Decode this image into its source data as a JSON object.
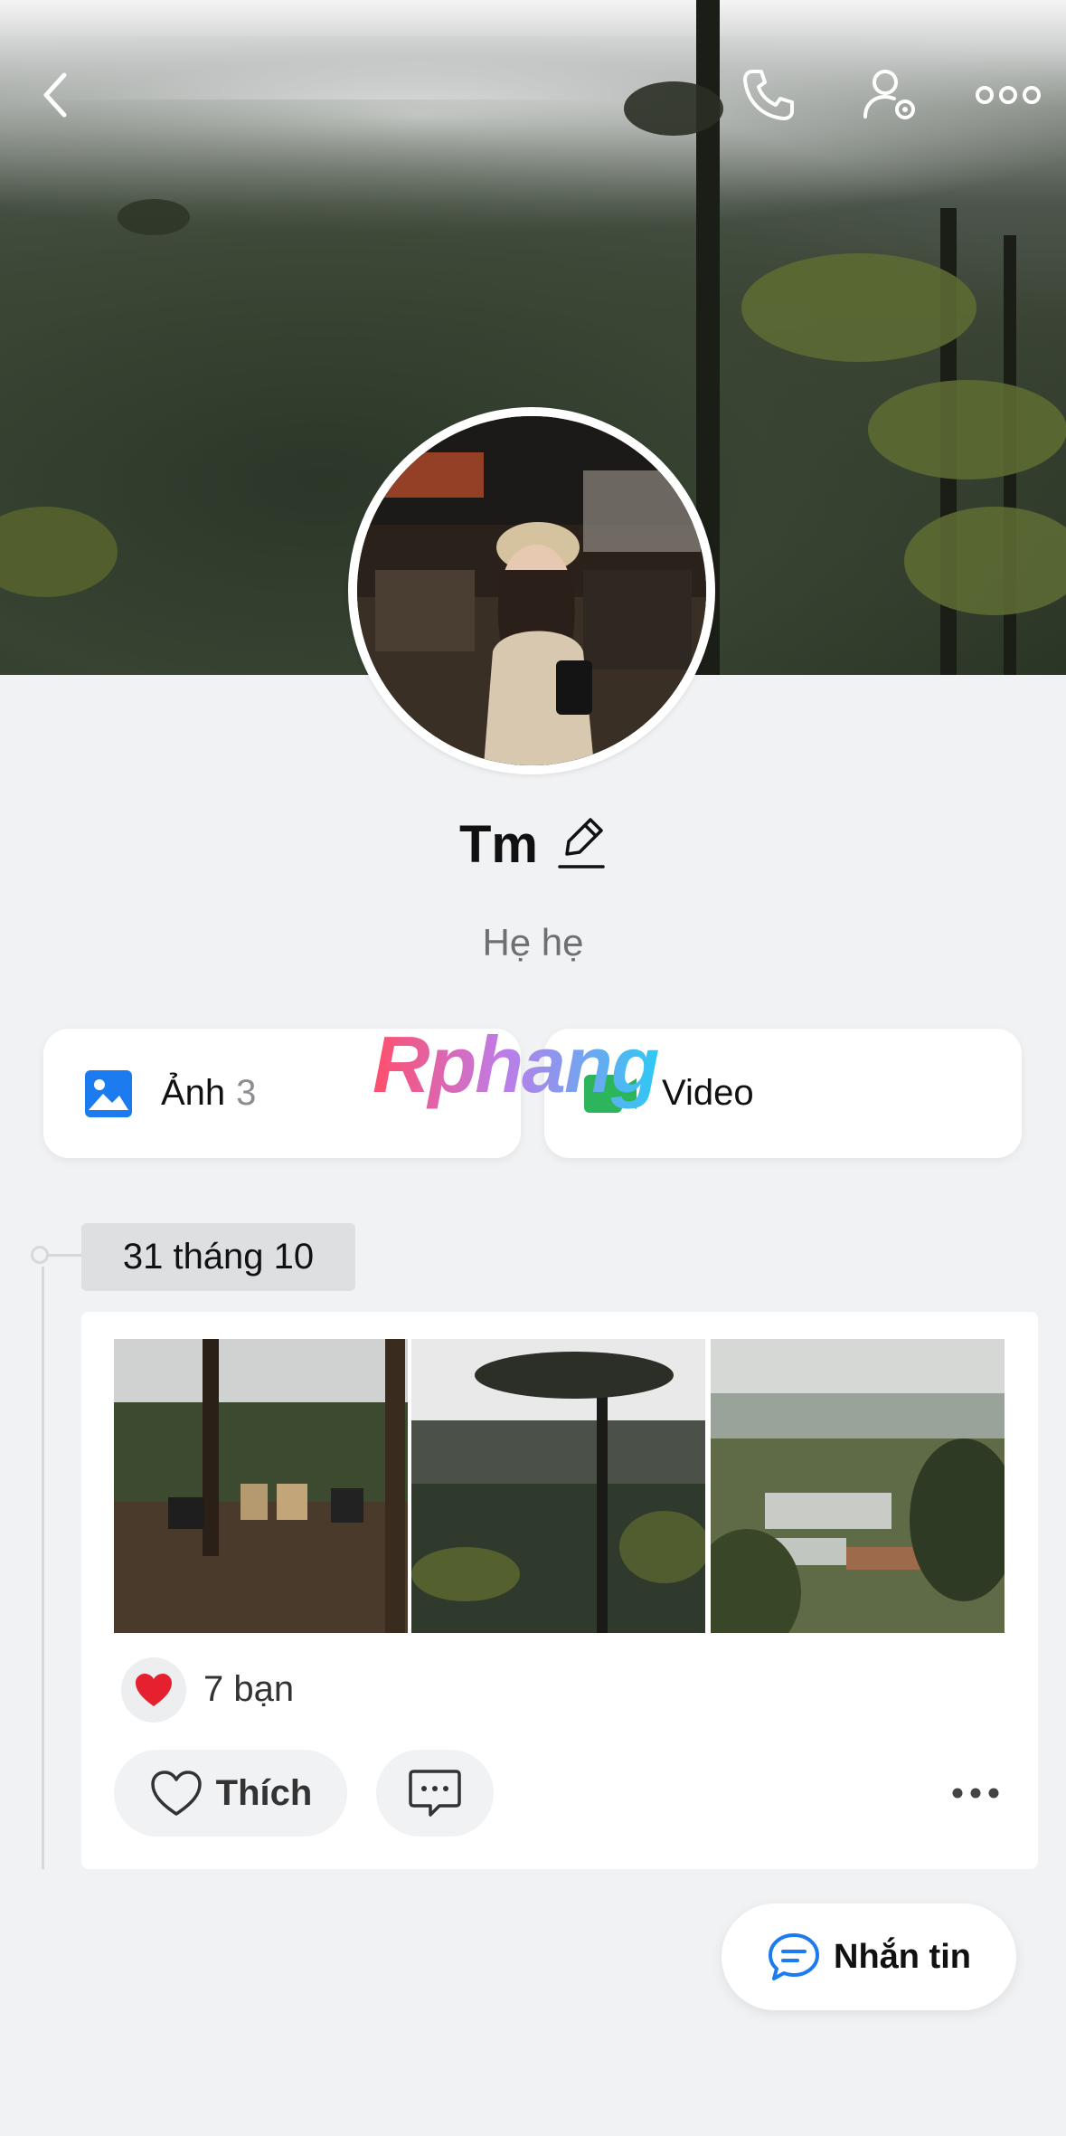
{
  "header": {
    "back_icon": "chevron-left-icon",
    "call_icon": "phone-icon",
    "settings_icon": "user-settings-icon",
    "more_icon": "more-horizontal-icon"
  },
  "profile": {
    "name": "Tm",
    "bio": "Hẹ hẹ",
    "edit_icon": "pencil-icon"
  },
  "media_tiles": [
    {
      "label": "Ảnh",
      "count": "3",
      "icon": "image-icon"
    },
    {
      "label": "Video",
      "icon": "video-icon"
    }
  ],
  "watermark": "Rphang",
  "timeline": {
    "date": "31 tháng 10"
  },
  "post": {
    "reaction_icon": "heart-icon",
    "reaction_count": "7 bạn",
    "like_label": "Thích",
    "comment_icon": "comment-icon",
    "more_icon": "more-horizontal-icon"
  },
  "fab": {
    "label": "Nhắn tin",
    "icon": "chat-bubble-icon"
  },
  "colors": {
    "background": "#f1f2f4",
    "card": "#ffffff",
    "accent_blue": "#1d7bf0",
    "video_green": "#2cb55a",
    "heart_red": "#e5202f"
  }
}
